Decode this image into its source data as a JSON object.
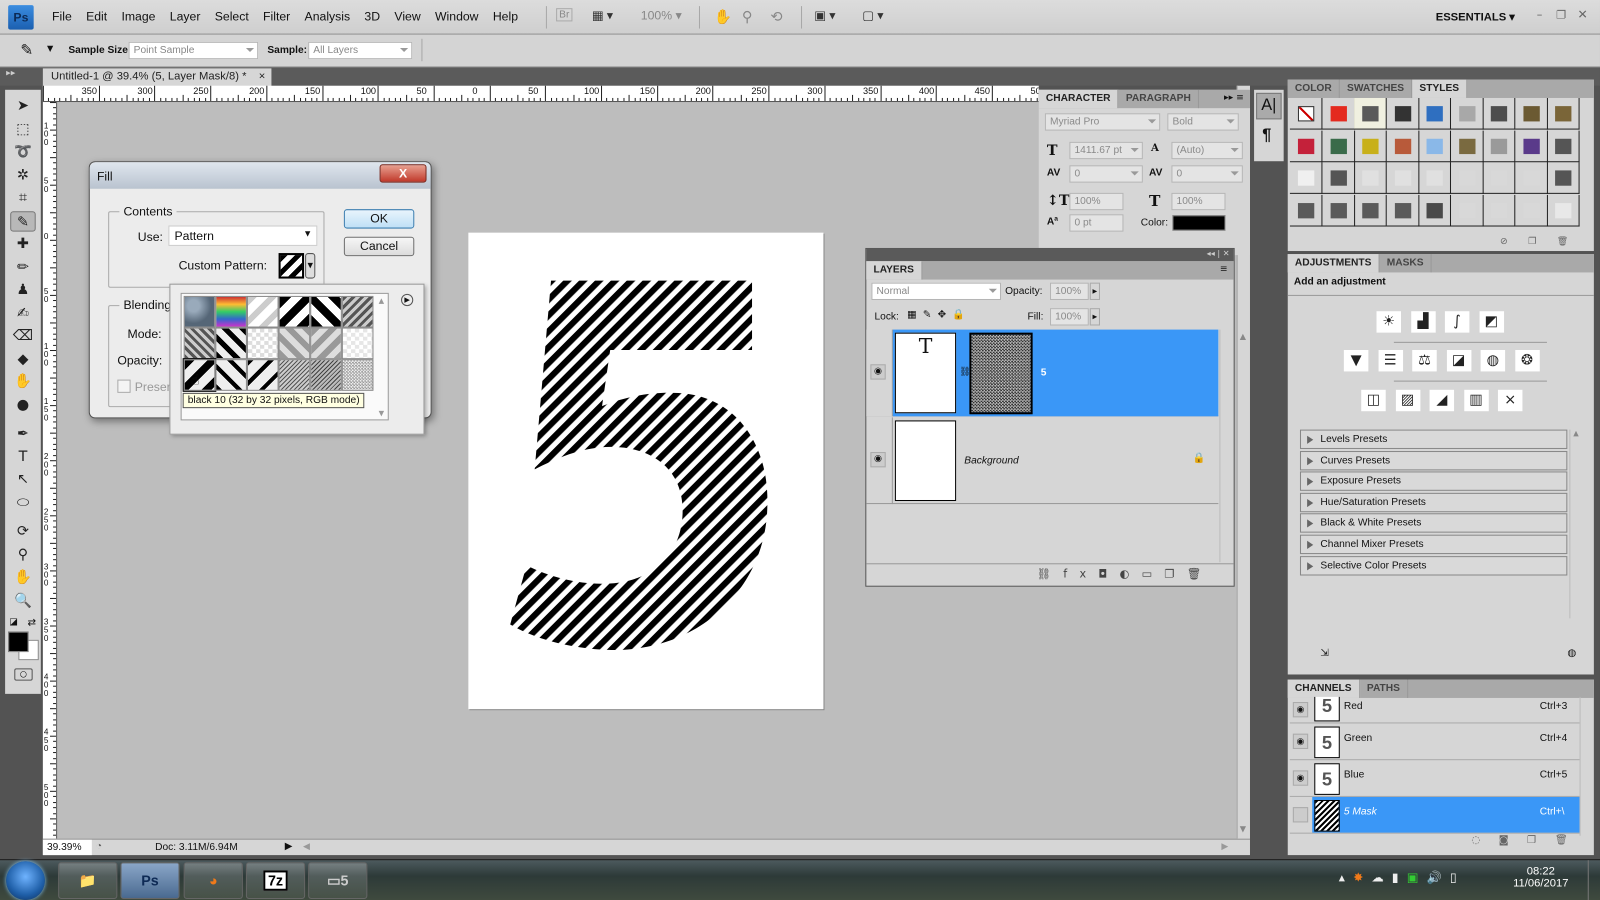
{
  "app": {
    "logo": "Ps",
    "workspace": "ESSENTIALS"
  },
  "menu": [
    "File",
    "Edit",
    "Image",
    "Layer",
    "Select",
    "Filter",
    "Analysis",
    "3D",
    "View",
    "Window",
    "Help"
  ],
  "appbar": {
    "bridge": "Br",
    "zoom": "100%"
  },
  "options": {
    "sample_size_label": "Sample Size:",
    "sample_size_value": "Point Sample",
    "sample_label": "Sample:",
    "sample_value": "All Layers"
  },
  "document": {
    "tab_title": "Untitled-1 @ 39.4% (5, Layer Mask/8) *",
    "close": "×"
  },
  "rulers": {
    "horizontal": [
      "350",
      "300",
      "250",
      "200",
      "150",
      "100",
      "50",
      "0",
      "50",
      "100",
      "150",
      "200",
      "250",
      "300",
      "350",
      "400",
      "450",
      "50"
    ],
    "vertical": [
      "1\n0\n0",
      "5\n0",
      "0",
      "5\n0",
      "1\n0\n0",
      "1\n5\n0",
      "2\n0\n0",
      "2\n5\n0",
      "3\n0\n0",
      "3\n5\n0",
      "4\n0\n0",
      "4\n5\n0",
      "5\n0\n0"
    ]
  },
  "tools": [
    "move-icon",
    "marquee-icon",
    "lasso-icon",
    "magic-wand-icon",
    "crop-icon",
    "eyedropper-icon",
    "healing-brush-icon",
    "brush-icon",
    "clone-stamp-icon",
    "history-brush-icon",
    "eraser-icon",
    "paint-bucket-icon",
    "blur-icon",
    "dodge-icon",
    "pen-icon",
    "type-icon",
    "path-selection-icon",
    "ellipse-icon",
    "3d-rotate-icon",
    "3d-orbit-icon",
    "hand-icon",
    "zoom-icon"
  ],
  "tool_glyphs": [
    "➤",
    "⬚",
    "➰",
    "✲",
    "⌗",
    "✎",
    "✚",
    "✏",
    "♟",
    "✍",
    "⌫",
    "◆",
    "✋",
    "●",
    "✒",
    "T",
    "↖",
    "⬭",
    "⟳",
    "⚲",
    "✋",
    "🔍"
  ],
  "colors": {
    "foreground": "#000000",
    "background": "#ffffff",
    "selection": "#3a97f7",
    "panel": "#d6d6d6"
  },
  "status": {
    "zoom": "39.39%",
    "doc": "Doc: 3.11M/6.94M"
  },
  "fill_dialog": {
    "title": "Fill",
    "contents_label": "Contents",
    "use_label": "Use:",
    "use_value": "Pattern",
    "custom_pattern_label": "Custom Pattern:",
    "blending_label": "Blending",
    "mode_label": "Mode:",
    "opacity_label": "Opacity:",
    "preserve_label": "Preserve Transparency",
    "ok": "OK",
    "cancel": "Cancel",
    "close": "X",
    "tooltip": "black 10 (32 by 32 pixels, RGB mode)"
  },
  "character": {
    "tabs": [
      "CHARACTER",
      "PARAGRAPH"
    ],
    "font": "Myriad Pro",
    "style": "Bold",
    "size": "1411.67 pt",
    "leading": "(Auto)",
    "kerning": "0",
    "tracking": "0",
    "vscale": "100%",
    "hscale": "100%",
    "baseline": "0 pt",
    "color_label": "Color:",
    "color": "#000000"
  },
  "layers": {
    "tab": "LAYERS",
    "blend": "Normal",
    "opacity_label": "Opacity:",
    "opacity": "100%",
    "lock_label": "Lock:",
    "fill_label": "Fill:",
    "fill": "100%",
    "items": [
      {
        "name": "5",
        "thumb": "T",
        "selected": true,
        "visible": true,
        "has_mask": true
      },
      {
        "name": "Background",
        "selected": false,
        "visible": true,
        "locked": true
      }
    ]
  },
  "styles_panel": {
    "tabs": [
      "COLOR",
      "SWATCHES",
      "STYLES"
    ],
    "swatches": [
      "none",
      "#e42a1f",
      "#5a5a5a",
      "#333333",
      "#2f6fc0",
      "#a8a8a8",
      "#4d4d4d",
      "#6b5a32",
      "#7a6538",
      "#c4213a",
      "#3a6b4a",
      "#c8b01a",
      "#b85a3a",
      "#8ab8e8",
      "#7a6a40",
      "#9a9a9a",
      "#5a3a8a",
      "#555555",
      "#f0f0f0",
      "#555555",
      "#e0e0e0",
      "#e0e0e0",
      "#e0e0e0",
      "#d8d8d8",
      "#d8d8d8",
      "#d8d8d8",
      "#555555",
      "#5a5a5a",
      "#5a5a5a",
      "#5a5a5a",
      "#5a5a5a",
      "#4a4a4a",
      "#d8d8d8",
      "#d8d8d8",
      "#d8d8d8",
      "#e8e8e8"
    ]
  },
  "adjustments": {
    "tabs": [
      "ADJUSTMENTS",
      "MASKS"
    ],
    "heading": "Add an adjustment",
    "icons": [
      [
        "brightness-contrast-icon",
        "levels-icon",
        "curves-icon",
        "exposure-icon"
      ],
      [
        "vibrance-icon",
        "hue-saturation-icon",
        "color-balance-icon",
        "black-white-icon",
        "photo-filter-icon",
        "channel-mixer-icon"
      ],
      [
        "invert-icon",
        "posterize-icon",
        "threshold-icon",
        "gradient-map-icon",
        "selective-color-icon"
      ]
    ],
    "glyphs": [
      [
        "☀",
        "▟",
        "∫",
        "◩"
      ],
      [
        "▼",
        "☰",
        "⚖",
        "◪",
        "◍",
        "❂"
      ],
      [
        "◫",
        "▨",
        "◢",
        "▥",
        "⨯"
      ]
    ],
    "presets": [
      "Levels Presets",
      "Curves Presets",
      "Exposure Presets",
      "Hue/Saturation Presets",
      "Black & White Presets",
      "Channel Mixer Presets",
      "Selective Color Presets"
    ]
  },
  "channels": {
    "tabs": [
      "CHANNELS",
      "PATHS"
    ],
    "items": [
      {
        "name": "Red",
        "shortcut": "Ctrl+3",
        "visible": true
      },
      {
        "name": "Green",
        "shortcut": "Ctrl+4",
        "visible": true
      },
      {
        "name": "Blue",
        "shortcut": "Ctrl+5",
        "visible": true
      },
      {
        "name": "5 Mask",
        "shortcut": "Ctrl+\\",
        "visible": false,
        "selected": true
      }
    ]
  },
  "taskbar": {
    "apps": [
      "Windows Explorer",
      "Ps",
      "Firefox",
      "7z",
      "Photoshop window"
    ],
    "time": "08:22",
    "date": "11/06/2017"
  }
}
